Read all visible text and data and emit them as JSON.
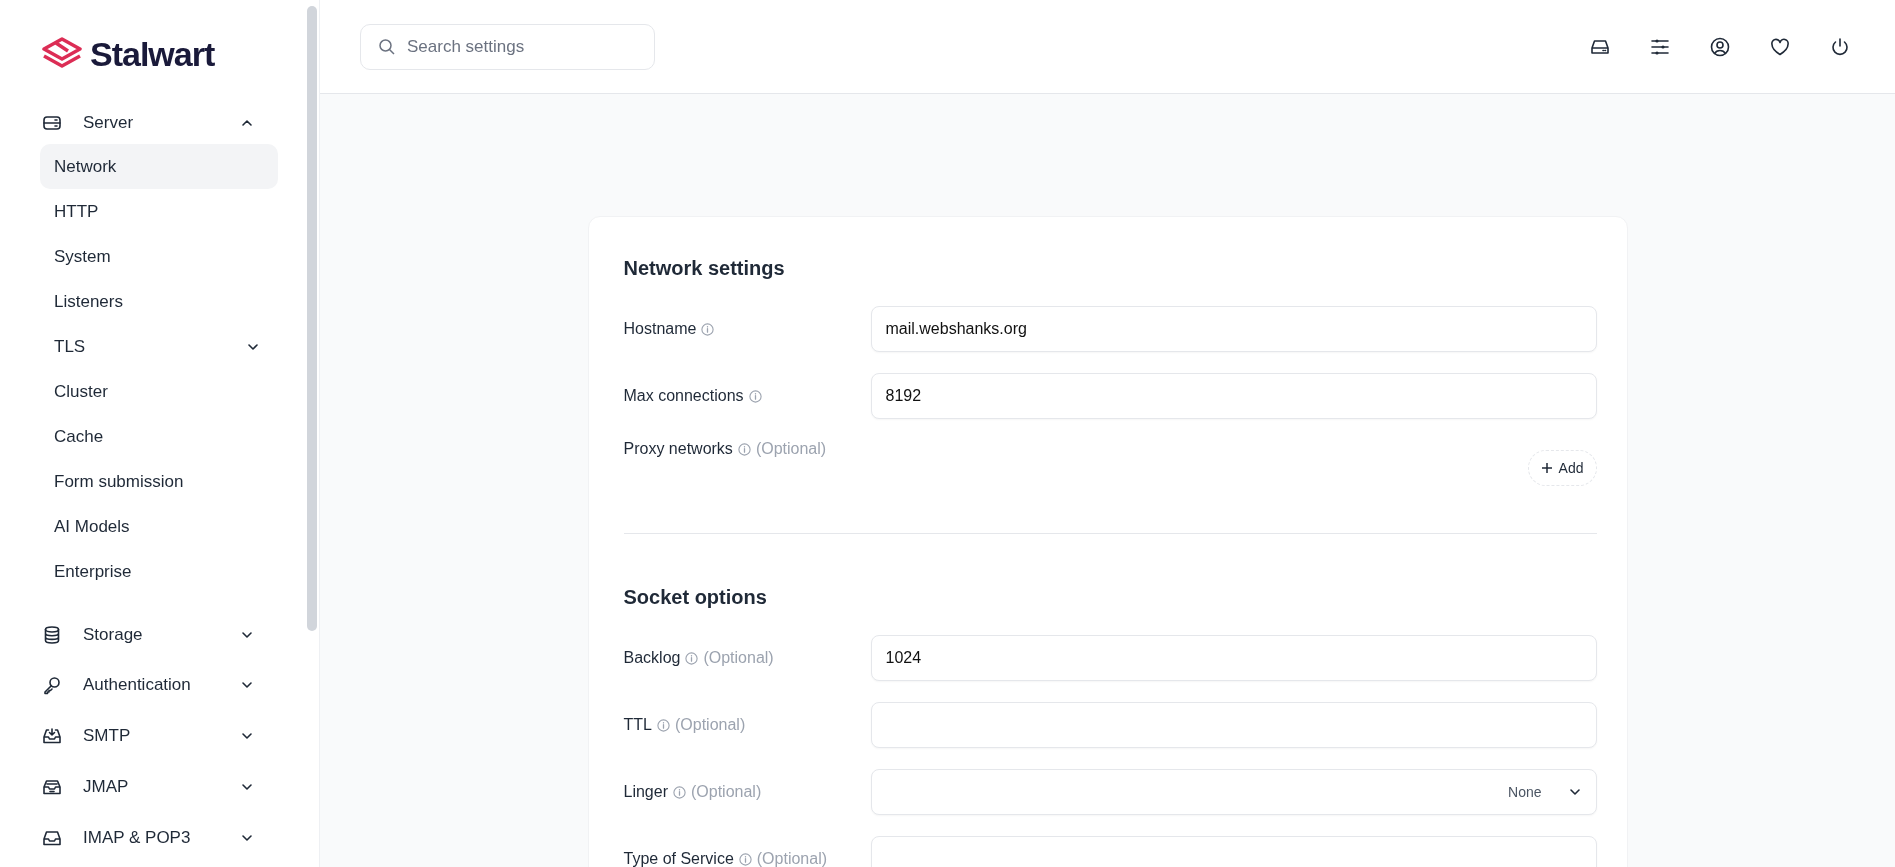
{
  "sidebar": {
    "logo": "Stalwart",
    "groups": [
      {
        "label": "Server",
        "expanded": true,
        "children": [
          {
            "label": "Network",
            "kind": "link",
            "selected": true
          },
          {
            "label": "HTTP",
            "kind": "link",
            "selected": false
          },
          {
            "label": "System",
            "kind": "link",
            "selected": false
          },
          {
            "label": "Listeners",
            "kind": "link",
            "selected": false
          },
          {
            "label": "TLS",
            "kind": "group",
            "selected": false,
            "expanded": false
          },
          {
            "label": "Cluster",
            "kind": "link",
            "selected": false
          },
          {
            "label": "Cache",
            "kind": "link",
            "selected": false
          },
          {
            "label": "Form submission",
            "kind": "link",
            "selected": false
          },
          {
            "label": "AI Models",
            "kind": "link",
            "selected": false
          },
          {
            "label": "Enterprise",
            "kind": "link",
            "selected": false
          }
        ]
      },
      {
        "label": "Storage",
        "expanded": false
      },
      {
        "label": "Authentication",
        "expanded": false
      },
      {
        "label": "SMTP",
        "expanded": false
      },
      {
        "label": "JMAP",
        "expanded": false
      },
      {
        "label": "IMAP & POP3",
        "expanded": false
      }
    ]
  },
  "header": {
    "search": {
      "placeholder": "Search settings"
    }
  },
  "sections": [
    {
      "title": "Network settings",
      "fields": [
        {
          "label": "Hostname",
          "kind": "text",
          "value": "mail.webshanks.org"
        },
        {
          "label": "Max connections",
          "kind": "text",
          "value": "8192"
        },
        {
          "label": "Proxy networks",
          "note": "(Optional)",
          "kind": "list",
          "add_label": "Add"
        }
      ]
    },
    {
      "title": "Socket options",
      "fields": [
        {
          "label": "Backlog",
          "note": "(Optional)",
          "kind": "text",
          "value": "1024"
        },
        {
          "label": "TTL",
          "note": "(Optional)",
          "kind": "text"
        },
        {
          "label": "Linger",
          "note": "(Optional)",
          "kind": "select",
          "value": "None"
        },
        {
          "label": "Type of Service",
          "note": "(Optional)",
          "kind": "text"
        }
      ]
    }
  ]
}
